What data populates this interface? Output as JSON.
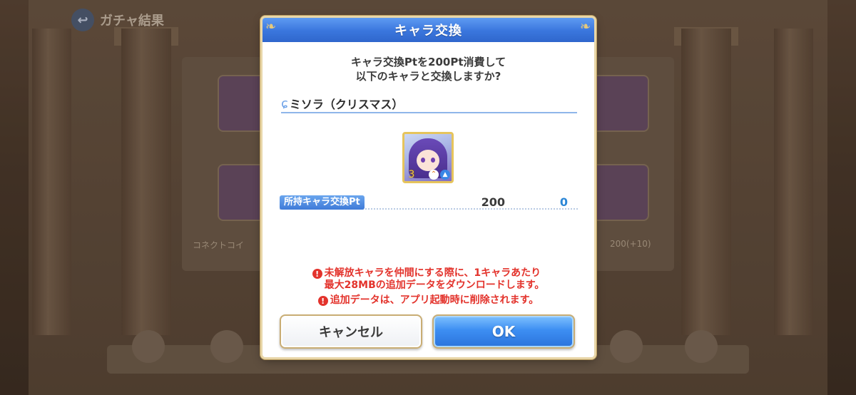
{
  "background": {
    "screen_title": "ガチャ結果",
    "back_label": "↩",
    "connect_text": "コネクトコイ",
    "points_text": "200(+10)"
  },
  "dialog": {
    "title": "キャラ交換",
    "message_line1": "キャラ交換Ptを200Pt消費して",
    "message_line2": "以下のキャラと交換しますか?",
    "character_name": "ミソラ（クリスマス）",
    "character_stars": "3",
    "points_label": "所持キャラ交換Pt",
    "points_current": "200",
    "points_after": "0",
    "warning_1_line1": "未解放キャラを仲間にする際に、1キャラあたり",
    "warning_1_line2": "最大28MBの追加データをダウンロードします。",
    "warning_2": "追加データは、アプリ起動時に削除されます。",
    "cancel_label": "キャンセル",
    "ok_label": "OK"
  },
  "colors": {
    "header_blue": "#3a76dd",
    "warning_red": "#e3332c",
    "points_after_blue": "#2c87d6",
    "gold_border": "#c9ad74"
  }
}
